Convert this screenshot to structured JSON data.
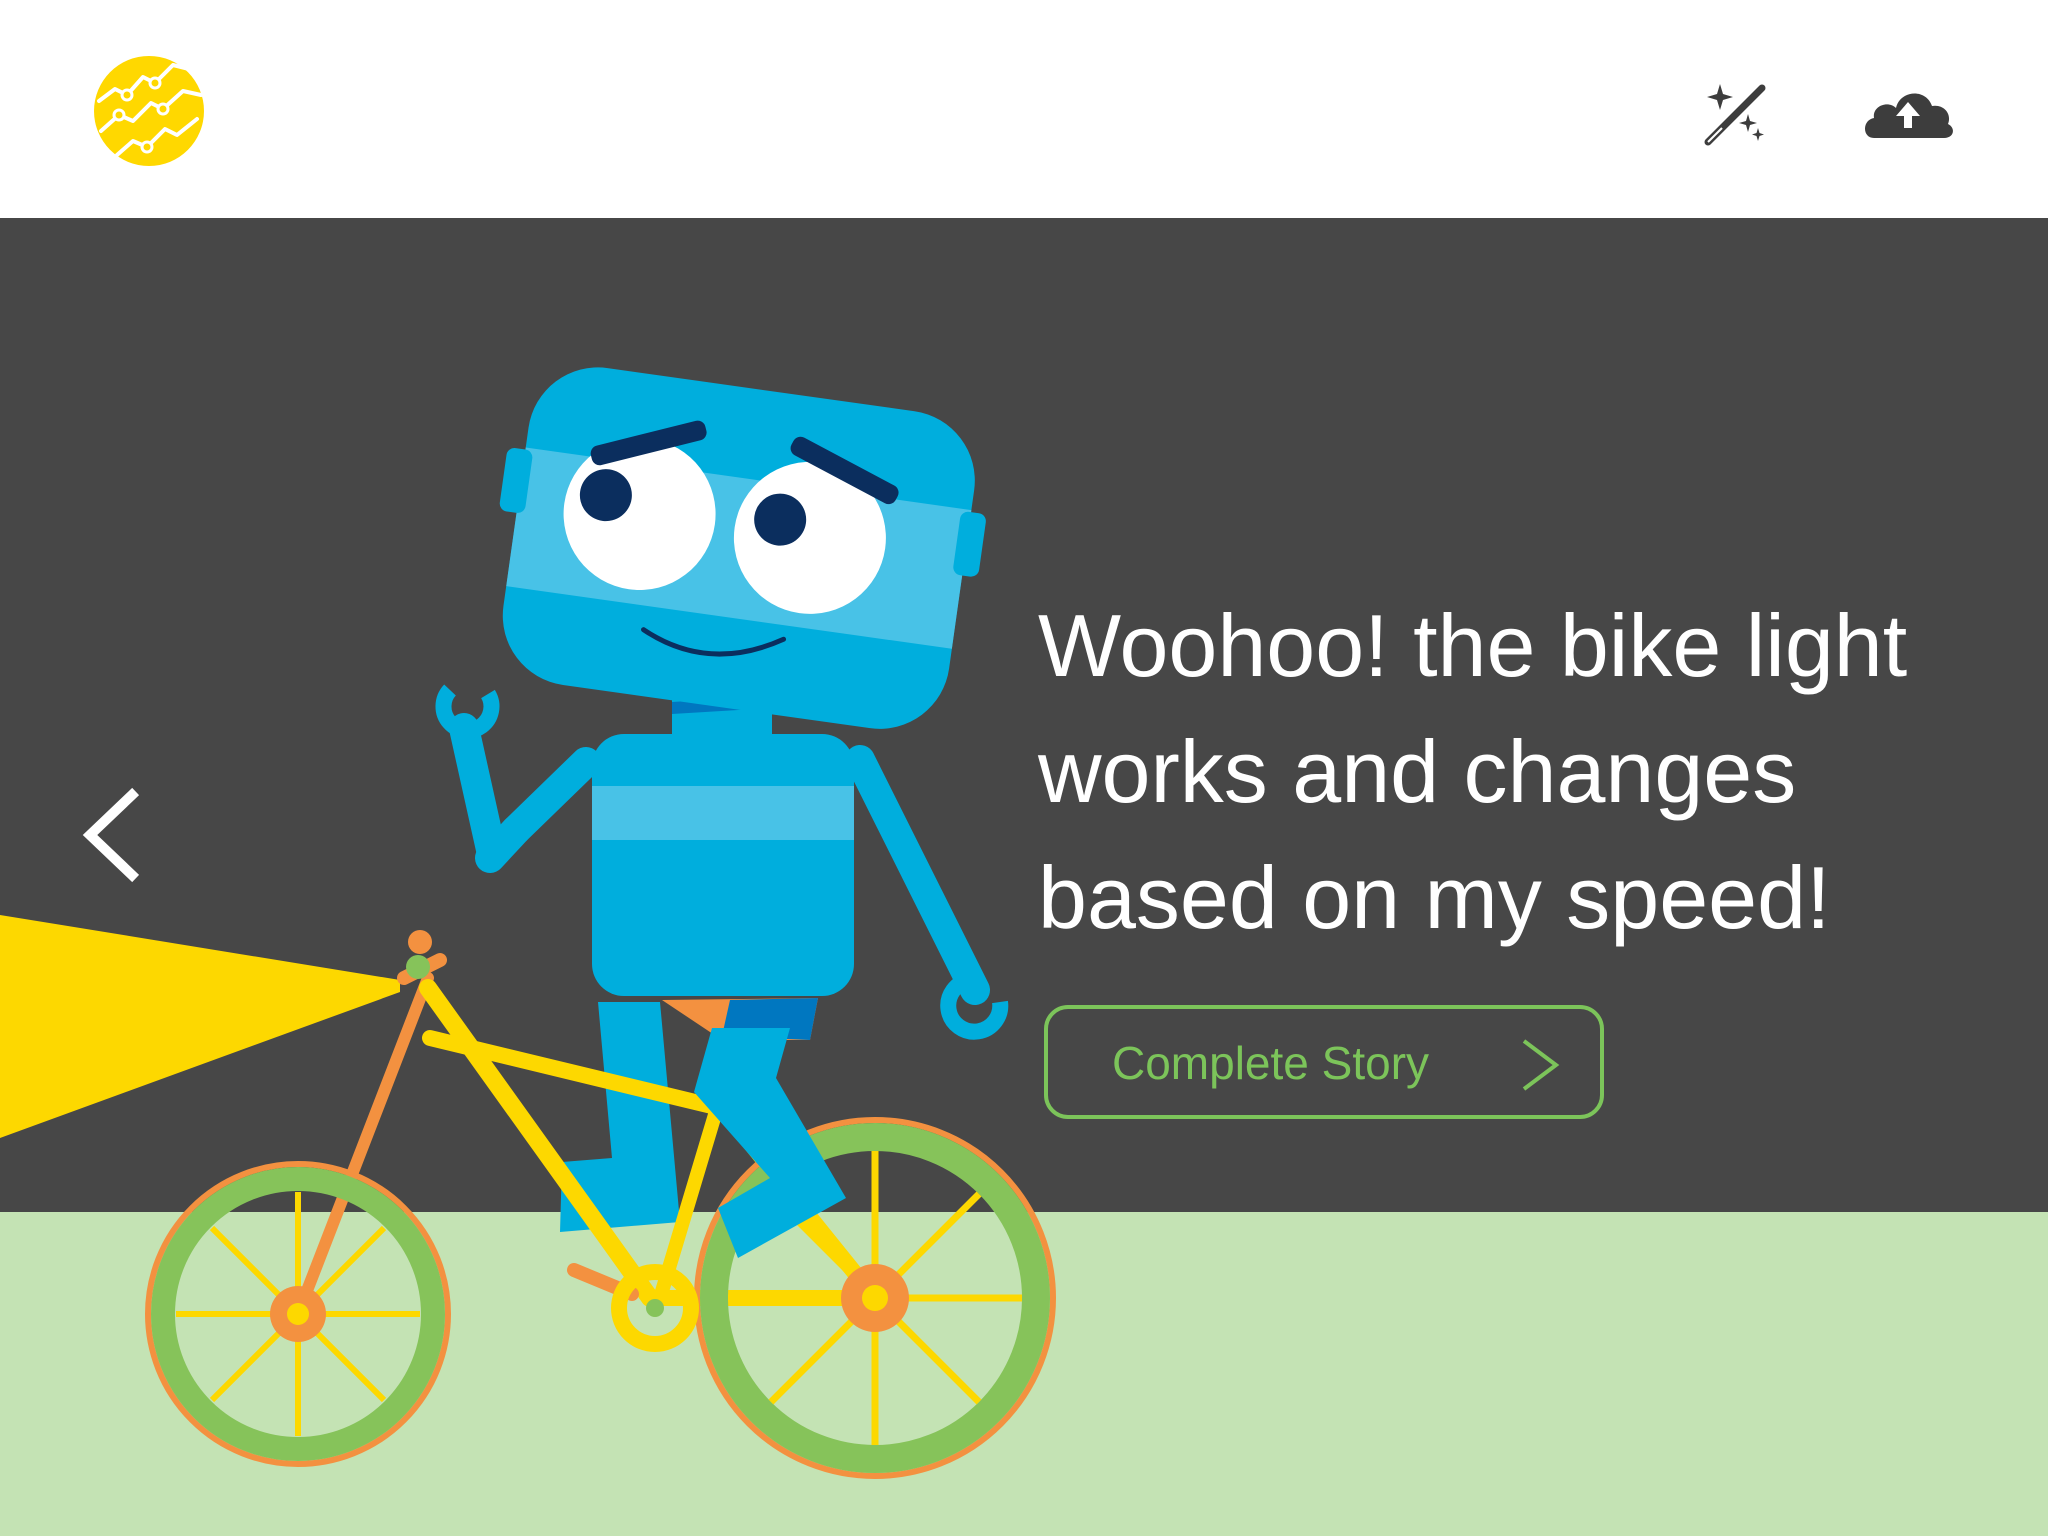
{
  "header": {
    "logo_icon": "yellow-circle-zigzag-logo",
    "buttons": [
      {
        "icon": "magic-wand-icon",
        "label": ""
      },
      {
        "icon": "cloud-upload-icon",
        "label": ""
      }
    ]
  },
  "story": {
    "text": "Woohoo! the bike light works and changes based on my speed!",
    "back_icon": "chevron-left-icon",
    "complete_button": {
      "label": "Complete Story",
      "icon": "chevron-right-icon"
    }
  },
  "colors": {
    "scene_bg": "#474747",
    "ground": "#c4e3b4",
    "robot_blue": "#00aedd",
    "bike_yellow": "#fdd800",
    "tire_green": "#86c35a",
    "accent_orange": "#f39140",
    "button_green": "#7cc45a",
    "logo_yellow": "#ffd800",
    "icon_gray": "#3d3d3d"
  }
}
